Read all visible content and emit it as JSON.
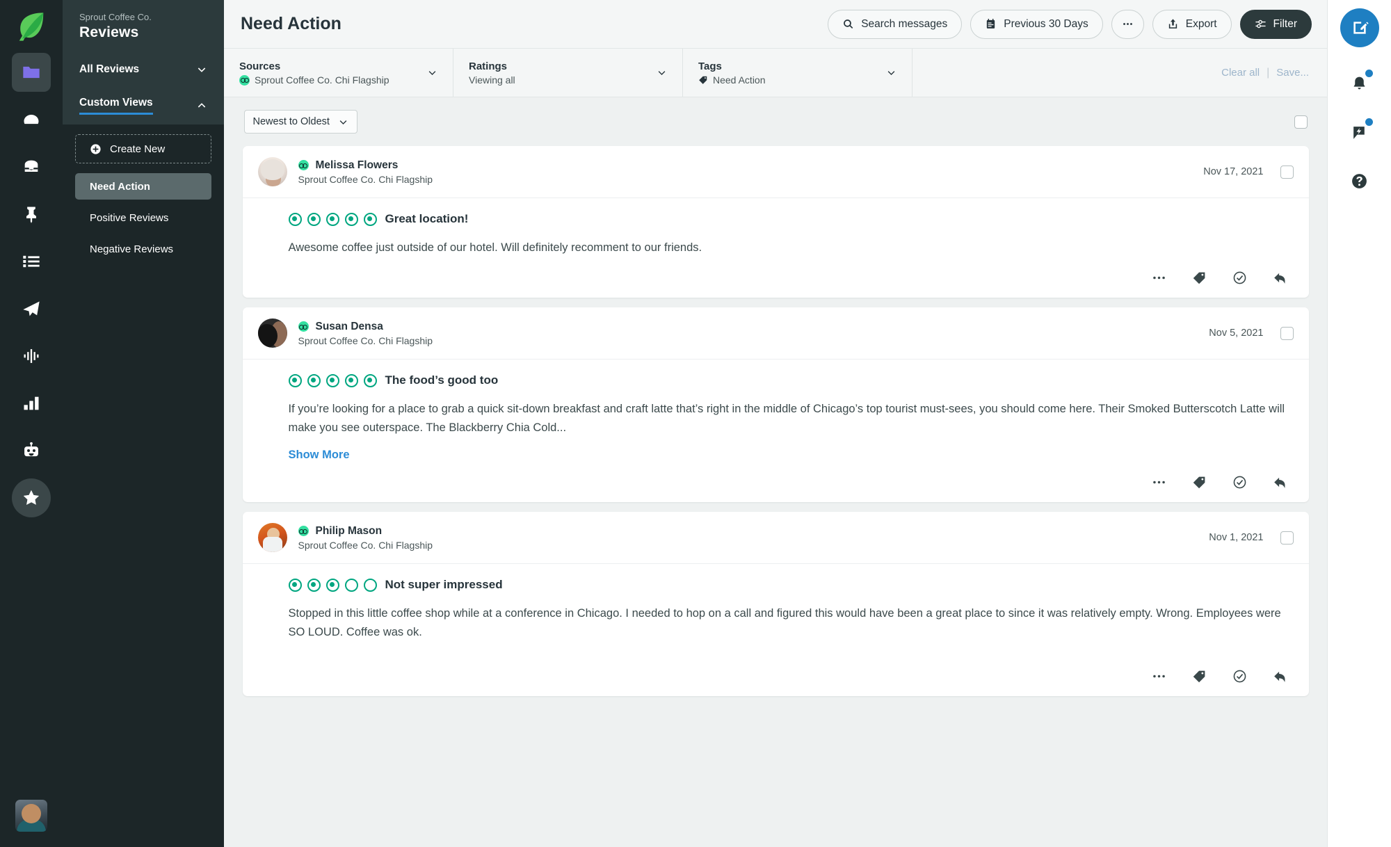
{
  "rail": {
    "logo_icon": "sprout-leaf-logo",
    "items": [
      {
        "icon": "folder-icon",
        "name": "publishing",
        "active": true
      },
      {
        "icon": "speedometer-icon",
        "name": "dashboard",
        "active": false
      },
      {
        "icon": "inbox-icon",
        "name": "smart-inbox",
        "active": false
      },
      {
        "icon": "pin-icon",
        "name": "pinned",
        "active": false
      },
      {
        "icon": "list-icon",
        "name": "tasks",
        "active": false
      },
      {
        "icon": "paper-plane-icon",
        "name": "publishing-send",
        "active": false
      },
      {
        "icon": "listening-waveform-icon",
        "name": "listening",
        "active": false
      },
      {
        "icon": "bar-chart-icon",
        "name": "reports",
        "active": false
      },
      {
        "icon": "bot-icon",
        "name": "bots",
        "active": false
      },
      {
        "icon": "half-star-icon",
        "name": "reviews",
        "active": true
      }
    ],
    "profile_avatar": "user-avatar"
  },
  "nav": {
    "brand": "Sprout Coffee Co.",
    "title": "Reviews",
    "sections": [
      {
        "label": "All Reviews",
        "expanded": false,
        "chevron": "chevron-down-icon"
      },
      {
        "label": "Custom Views",
        "expanded": true,
        "chevron": "chevron-up-icon"
      }
    ],
    "create_new": "Create New",
    "custom_views": [
      {
        "label": "Need Action",
        "selected": true
      },
      {
        "label": "Positive Reviews",
        "selected": false
      },
      {
        "label": "Negative Reviews",
        "selected": false
      }
    ]
  },
  "topbar": {
    "title": "Need Action",
    "search_label": "Search messages",
    "date_range_label": "Previous 30 Days",
    "more_label": "•••",
    "export_label": "Export",
    "filter_label": "Filter"
  },
  "filterbar": {
    "sources": {
      "label": "Sources",
      "value": "Sprout Coffee Co. Chi Flagship",
      "icon": "tripadvisor-icon"
    },
    "ratings": {
      "label": "Ratings",
      "value": "Viewing all"
    },
    "tags": {
      "label": "Tags",
      "value": "Need Action",
      "icon": "tag-icon"
    },
    "clear_all": "Clear all",
    "separator": "|",
    "save": "Save..."
  },
  "list": {
    "sort_value": "Newest to Oldest",
    "reviews": [
      {
        "author": "Melissa Flowers",
        "source": "Sprout Coffee Co. Chi Flagship",
        "network_icon": "tripadvisor-icon",
        "date": "Nov 17, 2021",
        "rating": 5,
        "max_rating": 5,
        "title": "Great location!",
        "text": "Awesome coffee just outside of our hotel. Will definitely recomment to our friends.",
        "show_more": null,
        "avatar": "av1"
      },
      {
        "author": "Susan Densa",
        "source": "Sprout Coffee Co. Chi Flagship",
        "network_icon": "tripadvisor-icon",
        "date": "Nov 5, 2021",
        "rating": 5,
        "max_rating": 5,
        "title": "The food’s good too",
        "text": "If you’re looking for a place to grab a quick sit-down breakfast and craft latte that’s right in the middle of Chicago’s top tourist must-sees, you should come here. Their Smoked Butterscotch Latte will make you see outerspace. The Blackberry Chia Cold...",
        "show_more": "Show More",
        "avatar": "av2"
      },
      {
        "author": "Philip Mason",
        "source": "Sprout Coffee Co. Chi Flagship",
        "network_icon": "tripadvisor-icon",
        "date": "Nov 1, 2021",
        "rating": 3,
        "max_rating": 5,
        "title": "Not super impressed",
        "text": "Stopped in this little coffee shop while at a conference in Chicago. I needed to hop on a call and figured this would have been a great place to since it was relatively empty. Wrong. Employees were SO LOUD. Coffee was ok.",
        "show_more": null,
        "avatar": "av3"
      }
    ],
    "card_actions": [
      "more-icon",
      "tag-icon",
      "complete-icon",
      "reply-icon"
    ]
  },
  "rightrail": {
    "compose_icon": "compose-icon",
    "items": [
      {
        "icon": "bell-icon",
        "name": "notifications",
        "badge": true
      },
      {
        "icon": "feedback-bolt-icon",
        "name": "whats-new",
        "badge": true
      },
      {
        "icon": "help-icon",
        "name": "help",
        "badge": false
      }
    ]
  },
  "colors": {
    "accent_blue": "#2c8cd6",
    "compose_blue": "#1e7fc2",
    "rating_green": "#00a680",
    "tripadvisor_green": "#34e0a1",
    "nav_dark": "#1c2628",
    "nav_head": "#2c3a3c"
  }
}
